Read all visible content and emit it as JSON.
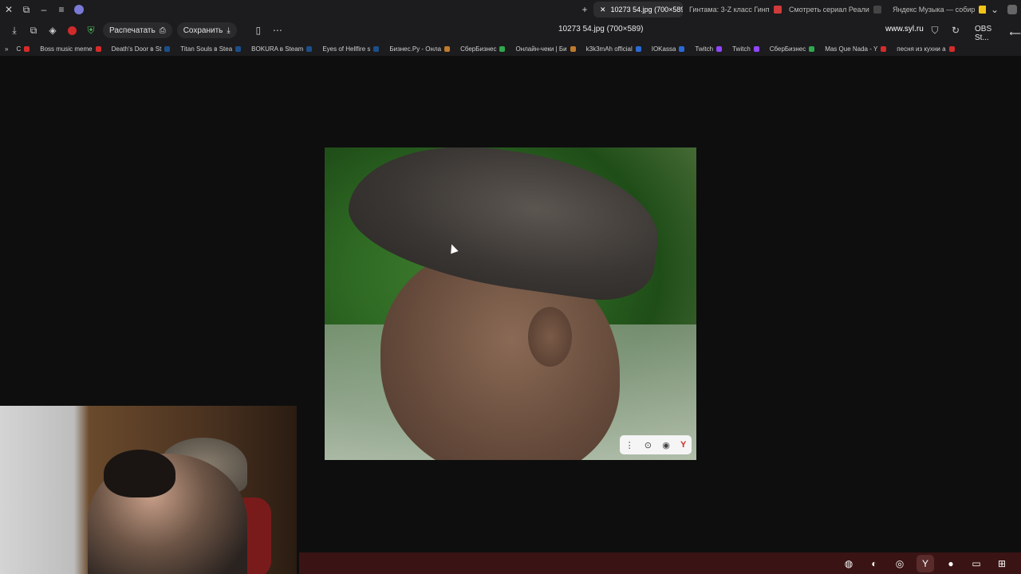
{
  "tabs": [
    {
      "label": "OBS St..."
    },
    {
      "label": "Яндекс Музыка — собир"
    },
    {
      "label": "Смотреть сериал Реали"
    },
    {
      "label": "Гинтама: 3-Z класс Гинп"
    },
    {
      "label": "10273 54.jpg (700×589)",
      "active": true
    }
  ],
  "window_controls": {
    "close": "✕",
    "restore": "⧉",
    "minimize": "–",
    "menu": "≡"
  },
  "address": {
    "page_title": "10273 54.jpg (700×589)",
    "domain": "www.syl.ru",
    "save_label": "Сохранить",
    "print_label": "Распечатать"
  },
  "bookmarks": [
    {
      "label": "песня из кухни a",
      "color": "#d62b2b"
    },
    {
      "label": "Mas Que Nada - Y",
      "color": "#d62b2b"
    },
    {
      "label": "СберБизнес",
      "color": "#2fa84f"
    },
    {
      "label": "Twitch",
      "color": "#9146ff"
    },
    {
      "label": "Twitch",
      "color": "#9146ff"
    },
    {
      "label": "IOKassa",
      "color": "#2a6ad6"
    },
    {
      "label": "k3k3mAh official",
      "color": "#2a6ad6"
    },
    {
      "label": "Онлайн-чеки | Би",
      "color": "#c07a2c"
    },
    {
      "label": "СберБизнес",
      "color": "#2fa84f"
    },
    {
      "label": "Бизнес.Ру - Онла",
      "color": "#c07a2c"
    },
    {
      "label": "Eyes of Hellfire s",
      "color": "#1b4f8a"
    },
    {
      "label": "BOKURA в Steam",
      "color": "#1b4f8a"
    },
    {
      "label": "Titan Souls в Stea",
      "color": "#1b4f8a"
    },
    {
      "label": "Death's Door в St",
      "color": "#1b4f8a"
    },
    {
      "label": "Boss music meme",
      "color": "#d62b2b"
    },
    {
      "label": "C",
      "color": "#d62b2b"
    }
  ],
  "photo_toolbar": {
    "more": "⋮",
    "lens": "⊙",
    "eye": "◉",
    "yandex": "Y"
  },
  "taskbar": {
    "icons": [
      "windows-icon",
      "files-icon",
      "chrome-icon",
      "yandex-icon",
      "obs-icon",
      "edge-icon",
      "app-icon"
    ],
    "glyphs": [
      "⊞",
      "▭",
      "●",
      "Y",
      "◎",
      "◐",
      "◍"
    ]
  }
}
